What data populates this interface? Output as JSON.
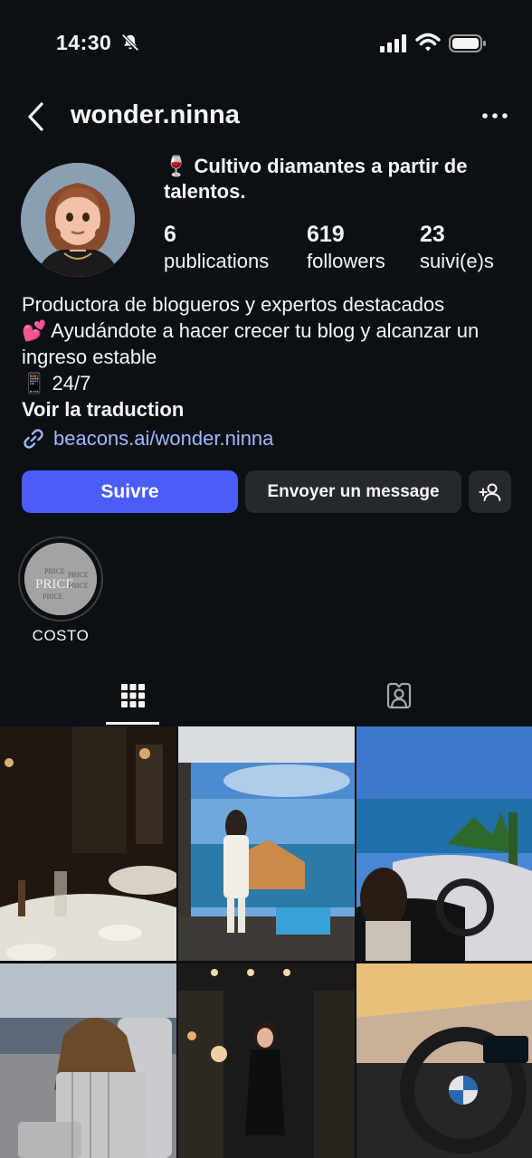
{
  "status_bar": {
    "time": "14:30",
    "icons": [
      "bell-slash-icon",
      "signal-icon",
      "wifi-icon",
      "battery-icon"
    ]
  },
  "header": {
    "username": "wonder.ninna",
    "back_icon": "chevron-left-icon",
    "more_icon": "more-dots-icon"
  },
  "profile": {
    "headline": "🍷 Cultivo diamantes a partir de talentos.",
    "stats": [
      {
        "value": "6",
        "label": "publications"
      },
      {
        "value": "619",
        "label": "followers"
      },
      {
        "value": "23",
        "label": "suivi(e)s"
      }
    ],
    "bio_lines": [
      "Productora de blogueros y expertos destacados",
      "💕 Ayudándote a hacer crecer tu blog y alcanzar un ingreso estable",
      "📱 24/7"
    ],
    "translate_label": "Voir la traduction",
    "link": "beacons.ai/wonder.ninna"
  },
  "actions": {
    "follow": "Suivre",
    "message": "Envoyer un message",
    "add_user_icon": "add-user-icon"
  },
  "highlights": [
    {
      "label": "COSTO",
      "cover_text": "PRICE"
    }
  ],
  "tabs": [
    {
      "name": "grid",
      "icon": "grid-icon",
      "active": true
    },
    {
      "name": "tagged",
      "icon": "tagged-person-icon",
      "active": false
    }
  ],
  "colors": {
    "background": "#0c1014",
    "accent": "#4a5df9",
    "link": "#a0b6ff",
    "button_secondary": "#25292e"
  }
}
